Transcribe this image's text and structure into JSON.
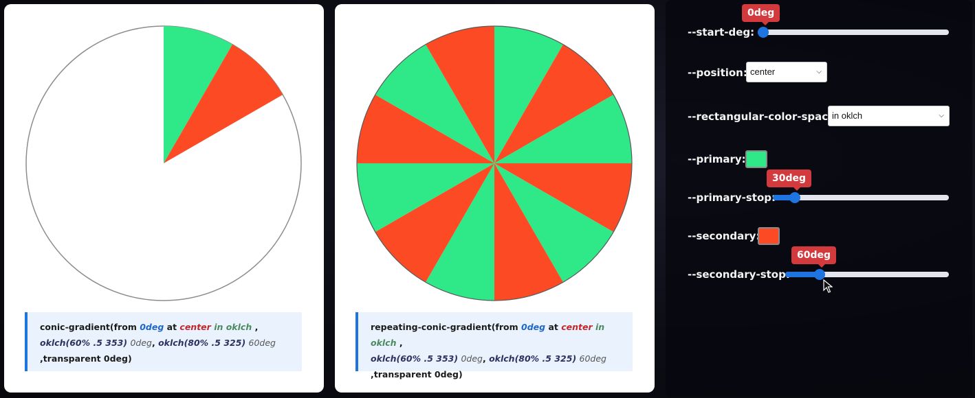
{
  "colors": {
    "primary": "#2fe887",
    "secondary": "#fc4a24",
    "accent": "#1e74e0",
    "tooltip": "#d23a3e"
  },
  "left_card": {
    "code": {
      "fn": "conic-gradient(from",
      "start": "0deg",
      "at": "at",
      "position": "center",
      "space": "in oklch",
      "comma1": ",",
      "c1": "oklch(60% .5 353)",
      "c1stop": "0deg",
      "comma2": ",",
      "c2": "oklch(80% .5 325)",
      "c2stop": "60deg",
      "tail": ",transparent 0deg)"
    },
    "pie": {
      "primary_stop_deg": 30,
      "secondary_stop_deg": 60
    }
  },
  "right_card": {
    "code": {
      "fn": "repeating-conic-gradient(from",
      "start": "0deg",
      "at": "at",
      "position": "center",
      "space": "in oklch",
      "comma1": ",",
      "c1": "oklch(60% .5 353)",
      "c1stop": "0deg",
      "comma2": ",",
      "c2": "oklch(80% .5 325)",
      "c2stop": "60deg",
      "tail": ",transparent 0deg)"
    },
    "pie": {
      "segment_deg": 30,
      "segments": 12
    }
  },
  "controls": {
    "start_deg": {
      "label": "--start-deg:",
      "value": "0deg",
      "fraction": 0.0
    },
    "position": {
      "label": "--position:",
      "selected": "center"
    },
    "color_space": {
      "label": "--rectangular-color-space:",
      "selected": "in oklch"
    },
    "primary": {
      "label": "--primary:"
    },
    "primary_stop": {
      "label": "--primary-stop:",
      "value": "30deg",
      "fraction": 0.1
    },
    "secondary": {
      "label": "--secondary:"
    },
    "secondary_stop": {
      "label": "--secondary-stop:",
      "value": "60deg",
      "fraction": 0.19
    }
  }
}
